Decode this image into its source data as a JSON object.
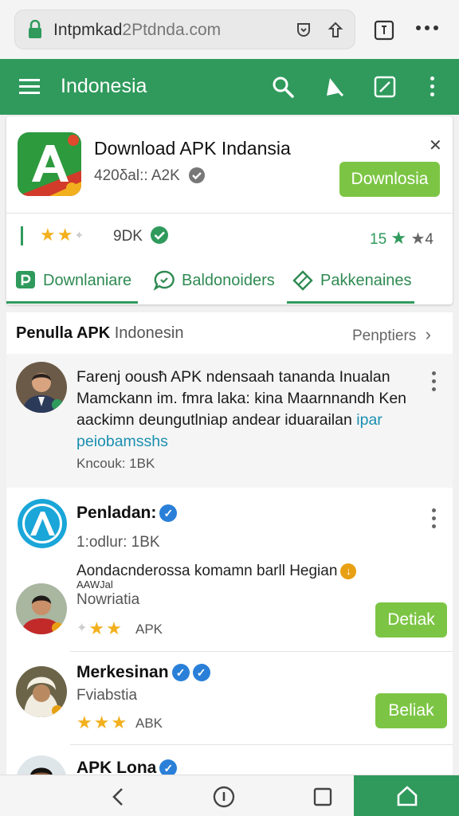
{
  "browser": {
    "url_main": "Intpmkad",
    "url_rest": "2Ptdnda.com"
  },
  "header": {
    "title": "Indonesia"
  },
  "app_card": {
    "name": "Download APK Indansia",
    "size": "420δal:: A2K",
    "download_label": "Downlosia",
    "rating_count": "9DK",
    "rating_right": "15",
    "rating_right_tail": "4",
    "tabs": [
      "Downlaniare",
      "Baldonoiders",
      "Pakkenaines"
    ]
  },
  "section": {
    "title_bold": "Penulla APK",
    "title_rest": "Indonesin",
    "more_label": "Penptiers"
  },
  "post": {
    "text": "Farenj oousħ APK ndensaah tananda Inualan Mamckann im. fmra laka: kina Maarnnandh Ken aackimn deungutlniap andear iduarailan",
    "text_link_a": "ipar",
    "text_link_b": "peiobamsshs",
    "meta": "Kncouk: 1BK"
  },
  "items": [
    {
      "title": "Penladan:",
      "sub": "1:odlur: 1BK",
      "line": "Aondacnderossa komamn barll Hegian",
      "tiny": "AAWJal",
      "line2": "Nowriatia",
      "apk": "APK",
      "button": "Detiak"
    },
    {
      "title": "Merkesinan",
      "line2": "Fviabstia",
      "apk": "ABK",
      "button": "Beliak"
    },
    {
      "title": "APK Lona"
    }
  ],
  "colors": {
    "primary": "#2f9a5c",
    "button": "#7cc544",
    "star": "#f2b01e",
    "verified": "#2a80d8"
  }
}
